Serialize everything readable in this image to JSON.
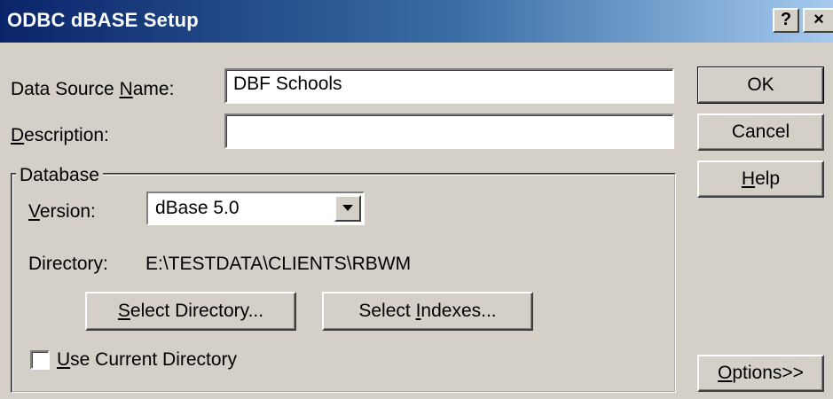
{
  "window": {
    "title": "ODBC dBASE Setup",
    "help_glyph": "?",
    "close_glyph": "×"
  },
  "form": {
    "dsn_label_pre": "Data Source ",
    "dsn_label_ul": "N",
    "dsn_label_post": "ame:",
    "dsn_value": "DBF Schools",
    "desc_label_ul": "D",
    "desc_label_post": "escription:",
    "desc_value": ""
  },
  "database": {
    "group_label": "Database",
    "version_label_ul": "V",
    "version_label_post": "ersion:",
    "version_value": "dBase 5.0",
    "directory_label": "Directory:",
    "directory_value": "E:\\TESTDATA\\CLIENTS\\RBWM",
    "select_dir_ul": "S",
    "select_dir_post": "elect Directory...",
    "select_idx_pre": "Select ",
    "select_idx_ul": "I",
    "select_idx_post": "ndexes...",
    "use_current_ul": "U",
    "use_current_post": "se Current Directory",
    "use_current_checked": false
  },
  "buttons": {
    "ok": "OK",
    "cancel": "Cancel",
    "help_ul": "H",
    "help_post": "elp",
    "options_ul": "O",
    "options_post": "ptions>>"
  },
  "icons": {
    "dropdown": "chevron-down-icon"
  },
  "colors": {
    "titlebar_start": "#0a246a",
    "titlebar_end": "#a6caf0",
    "face": "#d4d0c8"
  }
}
